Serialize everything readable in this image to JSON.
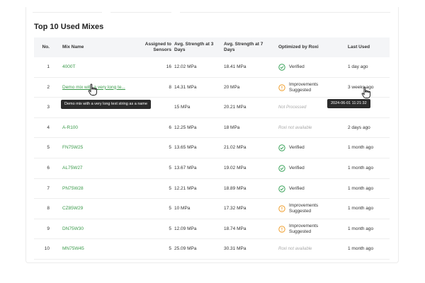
{
  "section": {
    "title": "Top 10 Used Mixes"
  },
  "columns": {
    "no": "No.",
    "mix_name": "Mix Name",
    "assigned": "Assigned to Sensors",
    "avg3": "Avg. Strength at 3 Days",
    "avg7": "Avg. Strength at 7 Days",
    "optimized": "Optimized by Roxi",
    "last_used": "Last Used"
  },
  "rows": [
    {
      "no": "1",
      "name": "4000T",
      "assigned": "16",
      "avg3": "12.02 MPa",
      "avg7": "18.41 MPa",
      "status": "Verified",
      "status_type": "verified",
      "last_used": "1 day ago"
    },
    {
      "no": "2",
      "name": "Demo mix with a very long te...",
      "assigned": "8",
      "avg3": "14.31 MPa",
      "avg7": "20 MPa",
      "status": "Improvements Suggested",
      "status_type": "improve",
      "last_used": "3 weeks ago"
    },
    {
      "no": "3",
      "name": "",
      "assigned": "",
      "avg3": "15 MPa",
      "avg7": "20.21 MPa",
      "status": "Not Processed",
      "status_type": "muted",
      "last_used": ""
    },
    {
      "no": "4",
      "name": "A-R100",
      "assigned": "6",
      "avg3": "12.25 MPa",
      "avg7": "18 MPa",
      "status": "Roxi not available",
      "status_type": "muted",
      "last_used": "2 days ago"
    },
    {
      "no": "5",
      "name": "FN75W25",
      "assigned": "5",
      "avg3": "13.65 MPa",
      "avg7": "21.02 MPa",
      "status": "Verified",
      "status_type": "verified",
      "last_used": "1 month ago"
    },
    {
      "no": "6",
      "name": "AL75W27",
      "assigned": "5",
      "avg3": "13.67 MPa",
      "avg7": "19.02 MPa",
      "status": "Verified",
      "status_type": "verified",
      "last_used": "1 month ago"
    },
    {
      "no": "7",
      "name": "PN75W28",
      "assigned": "5",
      "avg3": "12.21 MPa",
      "avg7": "18.89 MPa",
      "status": "Verified",
      "status_type": "verified",
      "last_used": "1 month ago"
    },
    {
      "no": "8",
      "name": "CZ85W29",
      "assigned": "5",
      "avg3": "10 MPa",
      "avg7": "17.32 MPa",
      "status": "Improvements Suggested",
      "status_type": "improve",
      "last_used": "1 month ago"
    },
    {
      "no": "9",
      "name": "DN75W30",
      "assigned": "5",
      "avg3": "12.09 MPa",
      "avg7": "18.74 MPa",
      "status": "Improvements Suggested",
      "status_type": "improve",
      "last_used": "1 month ago"
    },
    {
      "no": "10",
      "name": "MN75W45",
      "assigned": "5",
      "avg3": "25.09 MPa",
      "avg7": "30.31 MPa",
      "status": "Roxi not available",
      "status_type": "muted",
      "last_used": "1 month ago"
    }
  ],
  "tooltips": {
    "mix_name": "Demo mix with a very long text string as a name",
    "last_used": "2024-06-01 11:21:32"
  },
  "colors": {
    "link": "#3a9a4a",
    "verified": "#3aa35a",
    "improve": "#f0a030",
    "muted": "#aaaaaa",
    "tooltip_bg": "#2b2b2b"
  },
  "icons": {
    "verified": "check-circle-icon",
    "improve": "warning-circle-icon",
    "cursor": "hand-pointer-icon"
  }
}
